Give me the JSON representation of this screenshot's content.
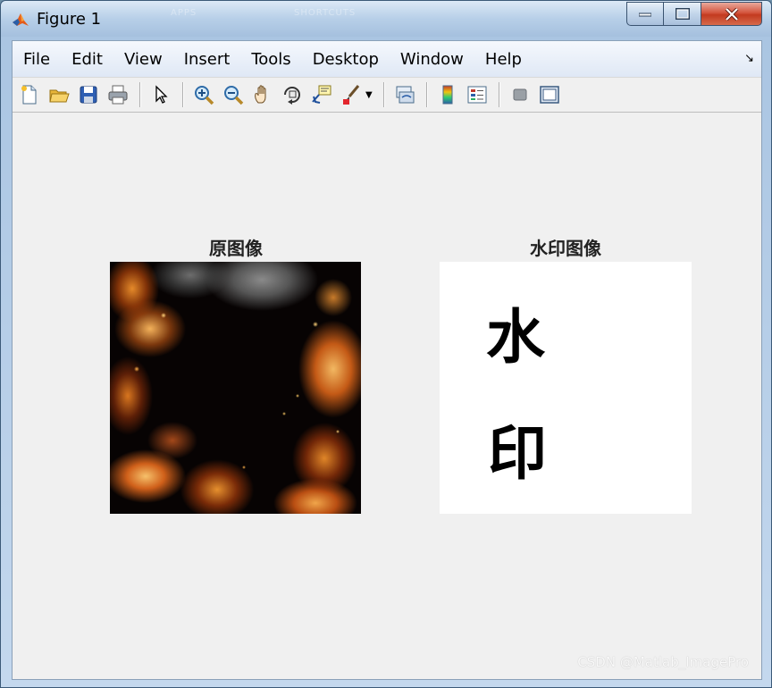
{
  "window": {
    "title": "Figure 1",
    "background_text": [
      "APPS",
      "SHORTCUTS"
    ]
  },
  "menu": {
    "items": [
      "File",
      "Edit",
      "View",
      "Insert",
      "Tools",
      "Desktop",
      "Window",
      "Help"
    ],
    "overflow_arrow": "↘"
  },
  "toolbar": {
    "icons": [
      "new-figure-icon",
      "open-file-icon",
      "save-icon",
      "print-icon",
      "edit-plot-icon",
      "zoom-in-icon",
      "zoom-out-icon",
      "pan-icon",
      "rotate-3d-icon",
      "data-cursor-icon",
      "brush-icon",
      "link-plot-icon",
      "colorbar-icon",
      "legend-icon",
      "hide-plot-tools-icon",
      "show-plot-tools-icon"
    ]
  },
  "axes": [
    {
      "title": "原图像",
      "image": "fire-texture"
    },
    {
      "title": "水印图像",
      "image": "watermark-text",
      "watermark_chars": [
        "水",
        "印"
      ]
    }
  ],
  "overlay": {
    "credit": "CSDN @Matlab_ImagePro"
  },
  "colors": {
    "client_bg": "#f0f0f0",
    "title_bar": "#b7cfe8",
    "close_button": "#c23a1f"
  }
}
